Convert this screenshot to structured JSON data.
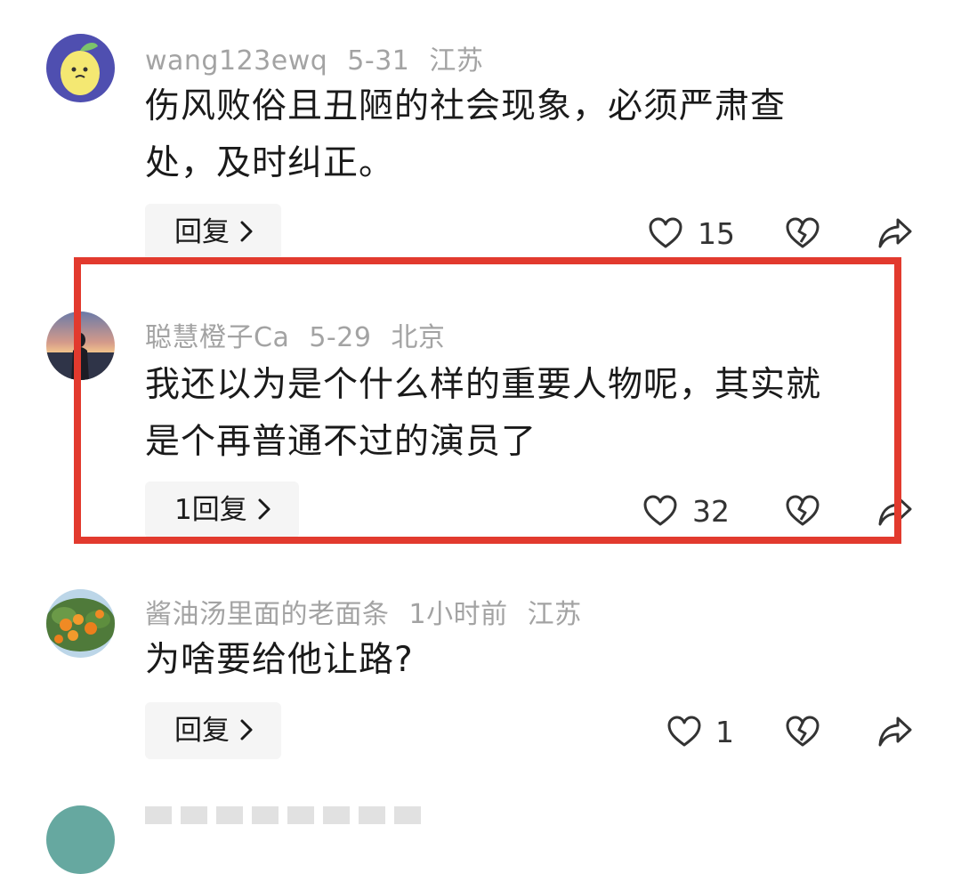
{
  "colors": {
    "highlight": "#e23a2e",
    "meta_gray": "#a3a3a3",
    "reply_bg": "#f5f5f5"
  },
  "comments": [
    {
      "username": "wang123ewq",
      "date": "5-31",
      "location": "江苏",
      "avatar_icon": "lemon-avatar",
      "text_line1": "伤风败俗且丑陋的社会现象，必须严肃查",
      "text_line2": "处，及时纠正。",
      "reply_label": "回复",
      "likes": "15"
    },
    {
      "username": "聪慧橙子Ca",
      "date": "5-29",
      "location": "北京",
      "avatar_icon": "sunset-person-avatar",
      "text_line1": "我还以为是个什么样的重要人物呢，其实就",
      "text_line2": "是个再普通不过的演员了",
      "reply_label": "1回复",
      "likes": "32"
    },
    {
      "username": "酱油汤里面的老面条",
      "date": "1小时前",
      "location": "江苏",
      "avatar_icon": "orange-tree-avatar",
      "text_line1": "为啥要给他让路?",
      "reply_label": "回复",
      "likes": "1"
    }
  ]
}
